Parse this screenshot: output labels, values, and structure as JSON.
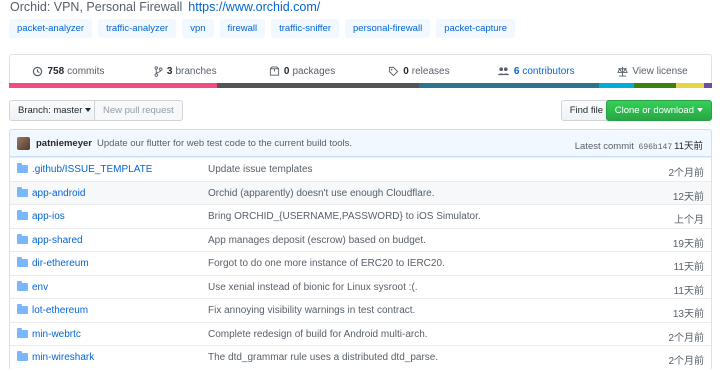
{
  "header": {
    "description": "Orchid: VPN, Personal Firewall",
    "website": "https://www.orchid.com/"
  },
  "topics": [
    "packet-analyzer",
    "traffic-analyzer",
    "vpn",
    "firewall",
    "traffic-sniffer",
    "personal-firewall",
    "packet-capture"
  ],
  "stats": {
    "commits_count": "758",
    "commits_label": "commits",
    "branches_count": "3",
    "branches_label": "branches",
    "packages_count": "0",
    "packages_label": "packages",
    "releases_count": "0",
    "releases_label": "releases",
    "contributors_count": "6",
    "contributors_label": "contributors",
    "license_label": "View license"
  },
  "language_colors": [
    "#f34b7d",
    "#555555",
    "#2b7489",
    "#00ADD8",
    "#3c7f13",
    "#e4d745",
    "#6e4c9f"
  ],
  "toolbar": {
    "branch_label": "Branch: master",
    "new_pr_label": "New pull request",
    "find_file_label": "Find file",
    "clone_label": "Clone or download"
  },
  "latest_commit": {
    "author": "patniemeyer",
    "message": "Update our flutter for web test code to the current build tools.",
    "label": "Latest commit",
    "sha": "696b147",
    "ago": "11天前"
  },
  "files": [
    {
      "name": ".github/ISSUE_TEMPLATE",
      "message": "Update issue templates",
      "age": "2个月前"
    },
    {
      "name": "app-android",
      "message": "Orchid (apparently) doesn't use enough Cloudflare.",
      "age": "12天前"
    },
    {
      "name": "app-ios",
      "message": "Bring ORCHID_{USERNAME,PASSWORD} to iOS Simulator.",
      "age": "上个月"
    },
    {
      "name": "app-shared",
      "message": "App manages deposit (escrow) based on budget.",
      "age": "19天前"
    },
    {
      "name": "dir-ethereum",
      "message": "Forgot to do one more instance of ERC20 to IERC20.",
      "age": "11天前"
    },
    {
      "name": "env",
      "message": "Use xenial instead of bionic for Linux sysroot :(.",
      "age": "11天前"
    },
    {
      "name": "lot-ethereum",
      "message": "Fix annoying visibility warnings in test contract.",
      "age": "13天前"
    },
    {
      "name": "min-webrtc",
      "message": "Complete redesign of build for Android multi-arch.",
      "age": "2个月前"
    },
    {
      "name": "min-wireshark",
      "message": "The dtd_grammar rule uses a distributed dtd_parse.",
      "age": "2个月前"
    }
  ]
}
